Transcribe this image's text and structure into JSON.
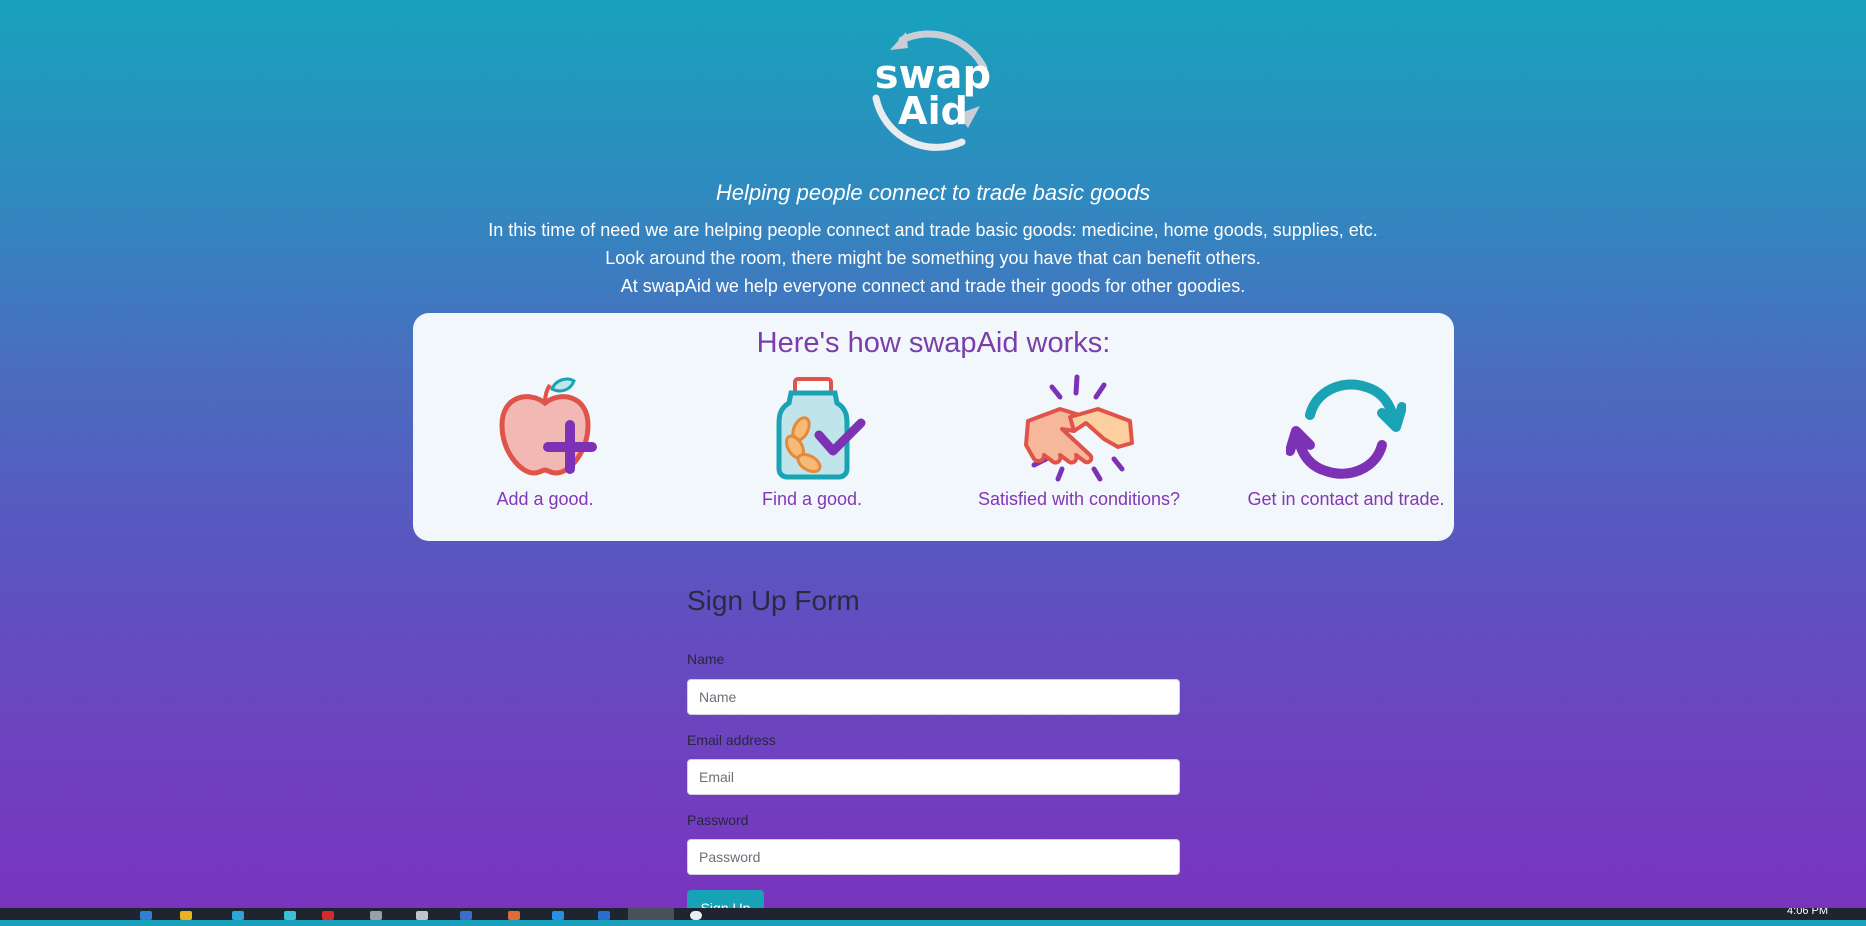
{
  "logo": {
    "line1": "swap",
    "line2": "Aid"
  },
  "tagline": "Helping people connect to trade basic goods",
  "intro": [
    "In this time of need we are helping people connect and trade basic goods: medicine, home goods, supplies, etc.",
    "Look around the room, there might be something you have that can benefit others.",
    "At swapAid we help everyone connect and trade their goods for other goodies."
  ],
  "how": {
    "title": "Here's how swapAid works:",
    "steps": [
      {
        "icon": "apple-plus-icon",
        "caption": "Add a good."
      },
      {
        "icon": "jar-check-icon",
        "caption": "Find a good."
      },
      {
        "icon": "handshake-icon",
        "caption": "Satisfied with conditions?"
      },
      {
        "icon": "cycle-arrows-icon",
        "caption": "Get in contact and trade."
      }
    ]
  },
  "form": {
    "title": "Sign Up Form",
    "name_label": "Name",
    "name_placeholder": "Name",
    "email_label": "Email address",
    "email_placeholder": "Email",
    "password_label": "Password",
    "password_placeholder": "Password",
    "submit_label": "Sign Up"
  },
  "taskbar": {
    "clock": "4:06 PM"
  },
  "colors": {
    "accent": "#17a2b8",
    "purple": "#8338b4",
    "card": "#f2f7fb"
  }
}
